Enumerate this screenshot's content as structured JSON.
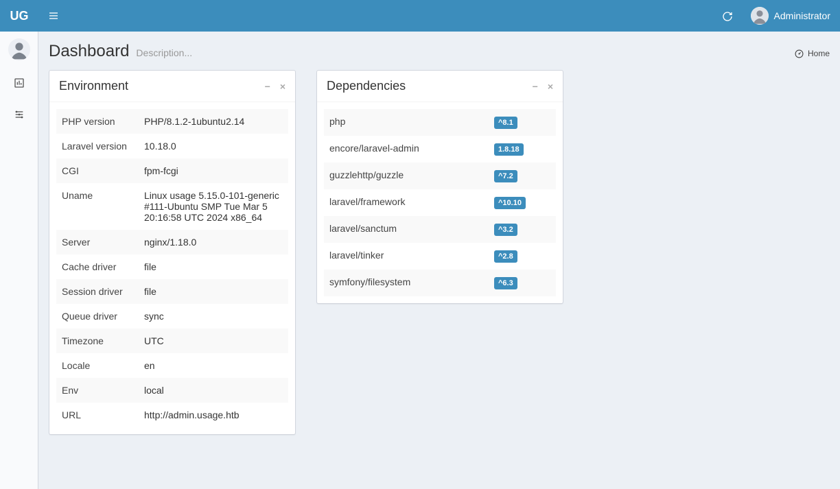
{
  "header": {
    "logo": "UG",
    "user_name": "Administrator"
  },
  "page": {
    "title": "Dashboard",
    "description": "Description..."
  },
  "breadcrumb": {
    "home": "Home"
  },
  "boxes": {
    "environment": {
      "title": "Environment",
      "rows": [
        {
          "label": "PHP version",
          "value": "PHP/8.1.2-1ubuntu2.14"
        },
        {
          "label": "Laravel version",
          "value": "10.18.0"
        },
        {
          "label": "CGI",
          "value": "fpm-fcgi"
        },
        {
          "label": "Uname",
          "value": "Linux usage 5.15.0-101-generic #111-Ubuntu SMP Tue Mar 5 20:16:58 UTC 2024 x86_64"
        },
        {
          "label": "Server",
          "value": "nginx/1.18.0"
        },
        {
          "label": "Cache driver",
          "value": "file"
        },
        {
          "label": "Session driver",
          "value": "file"
        },
        {
          "label": "Queue driver",
          "value": "sync"
        },
        {
          "label": "Timezone",
          "value": "UTC"
        },
        {
          "label": "Locale",
          "value": "en"
        },
        {
          "label": "Env",
          "value": "local"
        },
        {
          "label": "URL",
          "value": "http://admin.usage.htb"
        }
      ]
    },
    "dependencies": {
      "title": "Dependencies",
      "rows": [
        {
          "label": "php",
          "value": "^8.1"
        },
        {
          "label": "encore/laravel-admin",
          "value": "1.8.18"
        },
        {
          "label": "guzzlehttp/guzzle",
          "value": "^7.2"
        },
        {
          "label": "laravel/framework",
          "value": "^10.10"
        },
        {
          "label": "laravel/sanctum",
          "value": "^3.2"
        },
        {
          "label": "laravel/tinker",
          "value": "^2.8"
        },
        {
          "label": "symfony/filesystem",
          "value": "^6.3"
        }
      ]
    }
  }
}
